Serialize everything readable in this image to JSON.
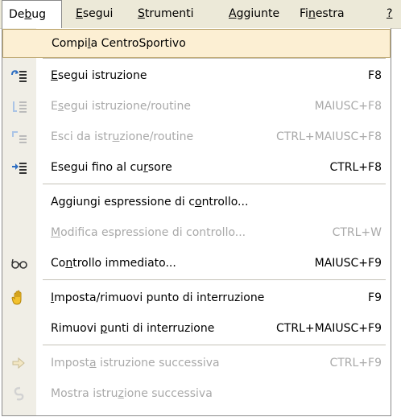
{
  "menubar": {
    "items": [
      {
        "pre": "De",
        "u": "b",
        "post": "ug"
      },
      {
        "pre": "",
        "u": "E",
        "post": "segui"
      },
      {
        "pre": "",
        "u": "S",
        "post": "trumenti"
      },
      {
        "pre": "",
        "u": "A",
        "post": "ggiunte"
      },
      {
        "pre": "Fi",
        "u": "n",
        "post": "estra"
      },
      {
        "pre": "",
        "u": "?",
        "post": ""
      }
    ]
  },
  "menu": {
    "compile": {
      "pre": "Compi",
      "u": "l",
      "post": "a CentroSportivo"
    },
    "step_into": {
      "pre": "",
      "u": "E",
      "post": "segui istruzione",
      "shortcut": "F8"
    },
    "step_over": {
      "pre": "E",
      "u": "s",
      "post": "egui istruzione/routine",
      "shortcut": "MAIUSC+F8"
    },
    "step_out": {
      "pre": "Esci da istr",
      "u": "u",
      "post": "zione/routine",
      "shortcut": "CTRL+MAIUSC+F8"
    },
    "run_to_cursor": {
      "pre": "Esegui fino al cu",
      "u": "r",
      "post": "sore",
      "shortcut": "CTRL+F8"
    },
    "add_watch": {
      "pre": "Aggiungi espressione di c",
      "u": "o",
      "post": "ntrollo..."
    },
    "edit_watch": {
      "pre": "",
      "u": "M",
      "post": "odifica espressione di controllo...",
      "shortcut": "CTRL+W"
    },
    "quick_watch": {
      "pre": "Co",
      "u": "n",
      "post": "trollo immediato...",
      "shortcut": "MAIUSC+F9"
    },
    "toggle_breakpoint": {
      "pre": "",
      "u": "I",
      "post": "mposta/rimuovi punto di interruzione",
      "shortcut": "F9"
    },
    "clear_breakpoints": {
      "pre": "Rimuovi ",
      "u": "p",
      "post": "unti di interruzione",
      "shortcut": "CTRL+MAIUSC+F9"
    },
    "set_next": {
      "pre": "Impost",
      "u": "a",
      "post": " istruzione successiva",
      "shortcut": "CTRL+F9"
    },
    "show_next": {
      "pre": "Mostra istru",
      "u": "z",
      "post": "ione successiva"
    }
  },
  "colors": {
    "menubar_bg": "#ece9d8",
    "highlight_bg": "#fcefd3",
    "highlight_border": "#bfa973",
    "disabled_text": "#a9a9a9",
    "gutter": "#f0eee6"
  }
}
